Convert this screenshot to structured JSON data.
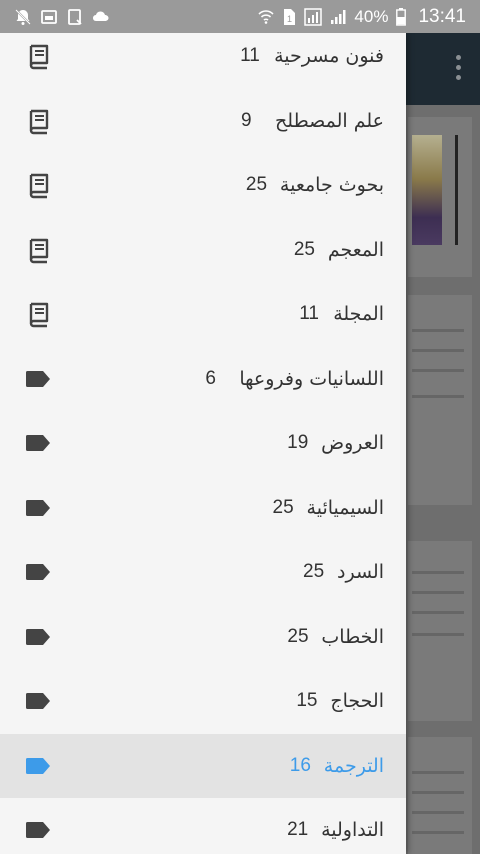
{
  "status_bar": {
    "battery_percent": "40%",
    "time": "13:41",
    "icons": [
      "notification-muted-icon",
      "image-icon",
      "tablet-icon",
      "cloud-icon",
      "wifi-icon",
      "sim-icon",
      "lte-icon",
      "signal-icon",
      "battery-icon"
    ]
  },
  "drawer": {
    "items": [
      {
        "count": "11",
        "label": "فنون مسرحية",
        "icon": "book-icon",
        "selected": false
      },
      {
        "count": "9",
        "label": "علم المصطلح",
        "icon": "book-icon",
        "selected": false
      },
      {
        "count": "25",
        "label": "بحوث جامعية",
        "icon": "book-icon",
        "selected": false
      },
      {
        "count": "25",
        "label": "المعجم",
        "icon": "book-icon",
        "selected": false
      },
      {
        "count": "11",
        "label": "المجلة",
        "icon": "book-icon",
        "selected": false
      },
      {
        "count": "6",
        "label": "اللسانيات وفروعها",
        "icon": "tag-icon",
        "selected": false
      },
      {
        "count": "19",
        "label": "العروض",
        "icon": "tag-icon",
        "selected": false
      },
      {
        "count": "25",
        "label": "السيميائية",
        "icon": "tag-icon",
        "selected": false
      },
      {
        "count": "25",
        "label": "السرد",
        "icon": "tag-icon",
        "selected": false
      },
      {
        "count": "25",
        "label": "الخطاب",
        "icon": "tag-icon",
        "selected": false
      },
      {
        "count": "15",
        "label": "الحجاج",
        "icon": "tag-icon",
        "selected": false
      },
      {
        "count": "16",
        "label": "الترجمة",
        "icon": "tag-icon",
        "selected": true
      },
      {
        "count": "21",
        "label": "التداولية",
        "icon": "tag-icon",
        "selected": false
      }
    ]
  },
  "colors": {
    "selected_accent": "#3d9be9",
    "icon_default": "#444444",
    "drawer_background": "#f5f5f5",
    "status_bar": "#9a9a9a",
    "toolbar": "#1e2a33"
  }
}
